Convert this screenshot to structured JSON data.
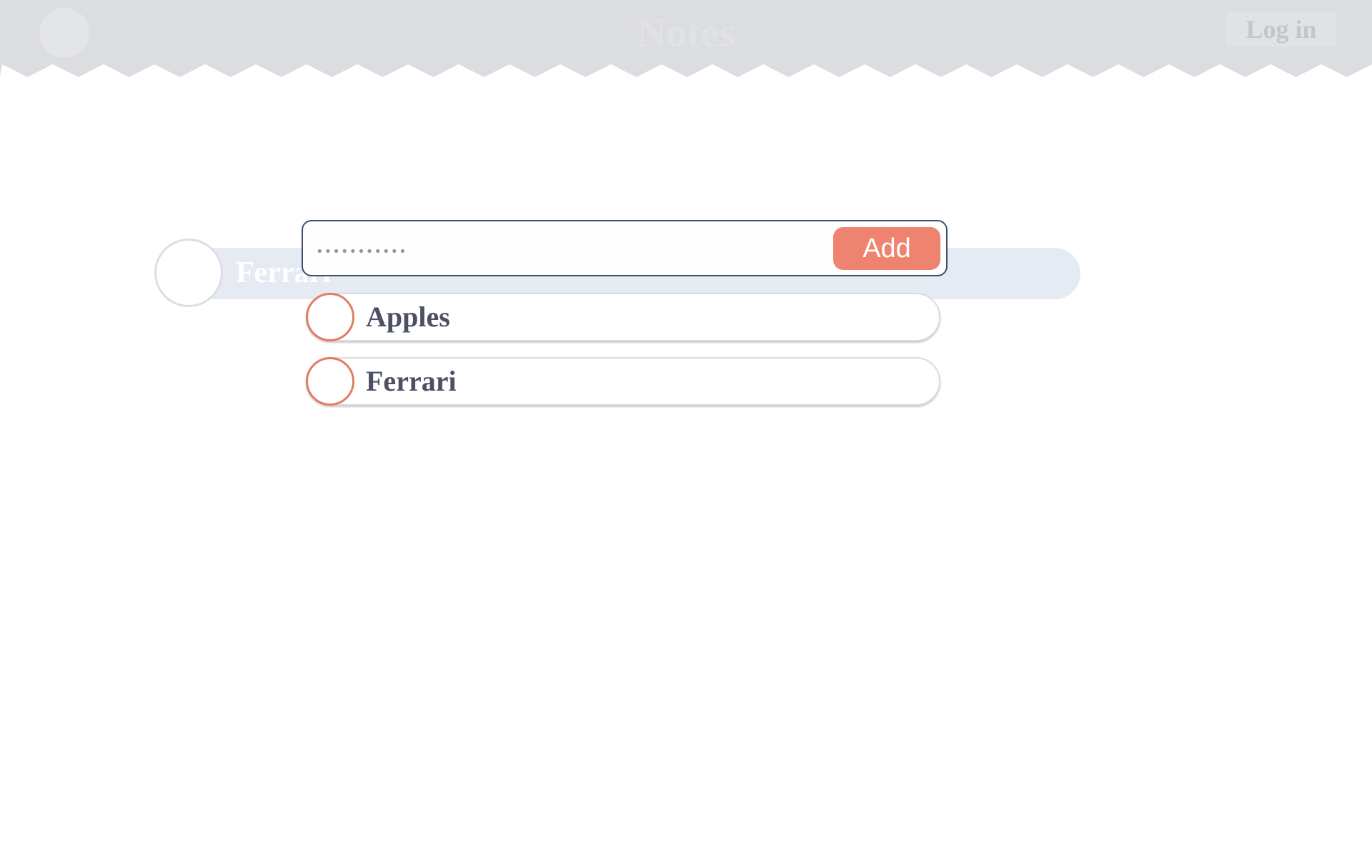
{
  "header": {
    "title": "Notes",
    "login_label": "Log in"
  },
  "dragging_item": {
    "label": "Ferrari"
  },
  "add_form": {
    "input_value": "",
    "placeholder": "•••••••••••",
    "add_label": "Add"
  },
  "notes": [
    {
      "label": "Apples",
      "done": false
    },
    {
      "label": "Ferrari",
      "done": false
    }
  ],
  "colors": {
    "header_bg": "#dcdde0",
    "accent": "#ee8470",
    "checkbox_ring": "#e27c66",
    "text": "#4d5062",
    "input_border": "#3f5169",
    "ghost_bg": "#e6ebf3"
  }
}
